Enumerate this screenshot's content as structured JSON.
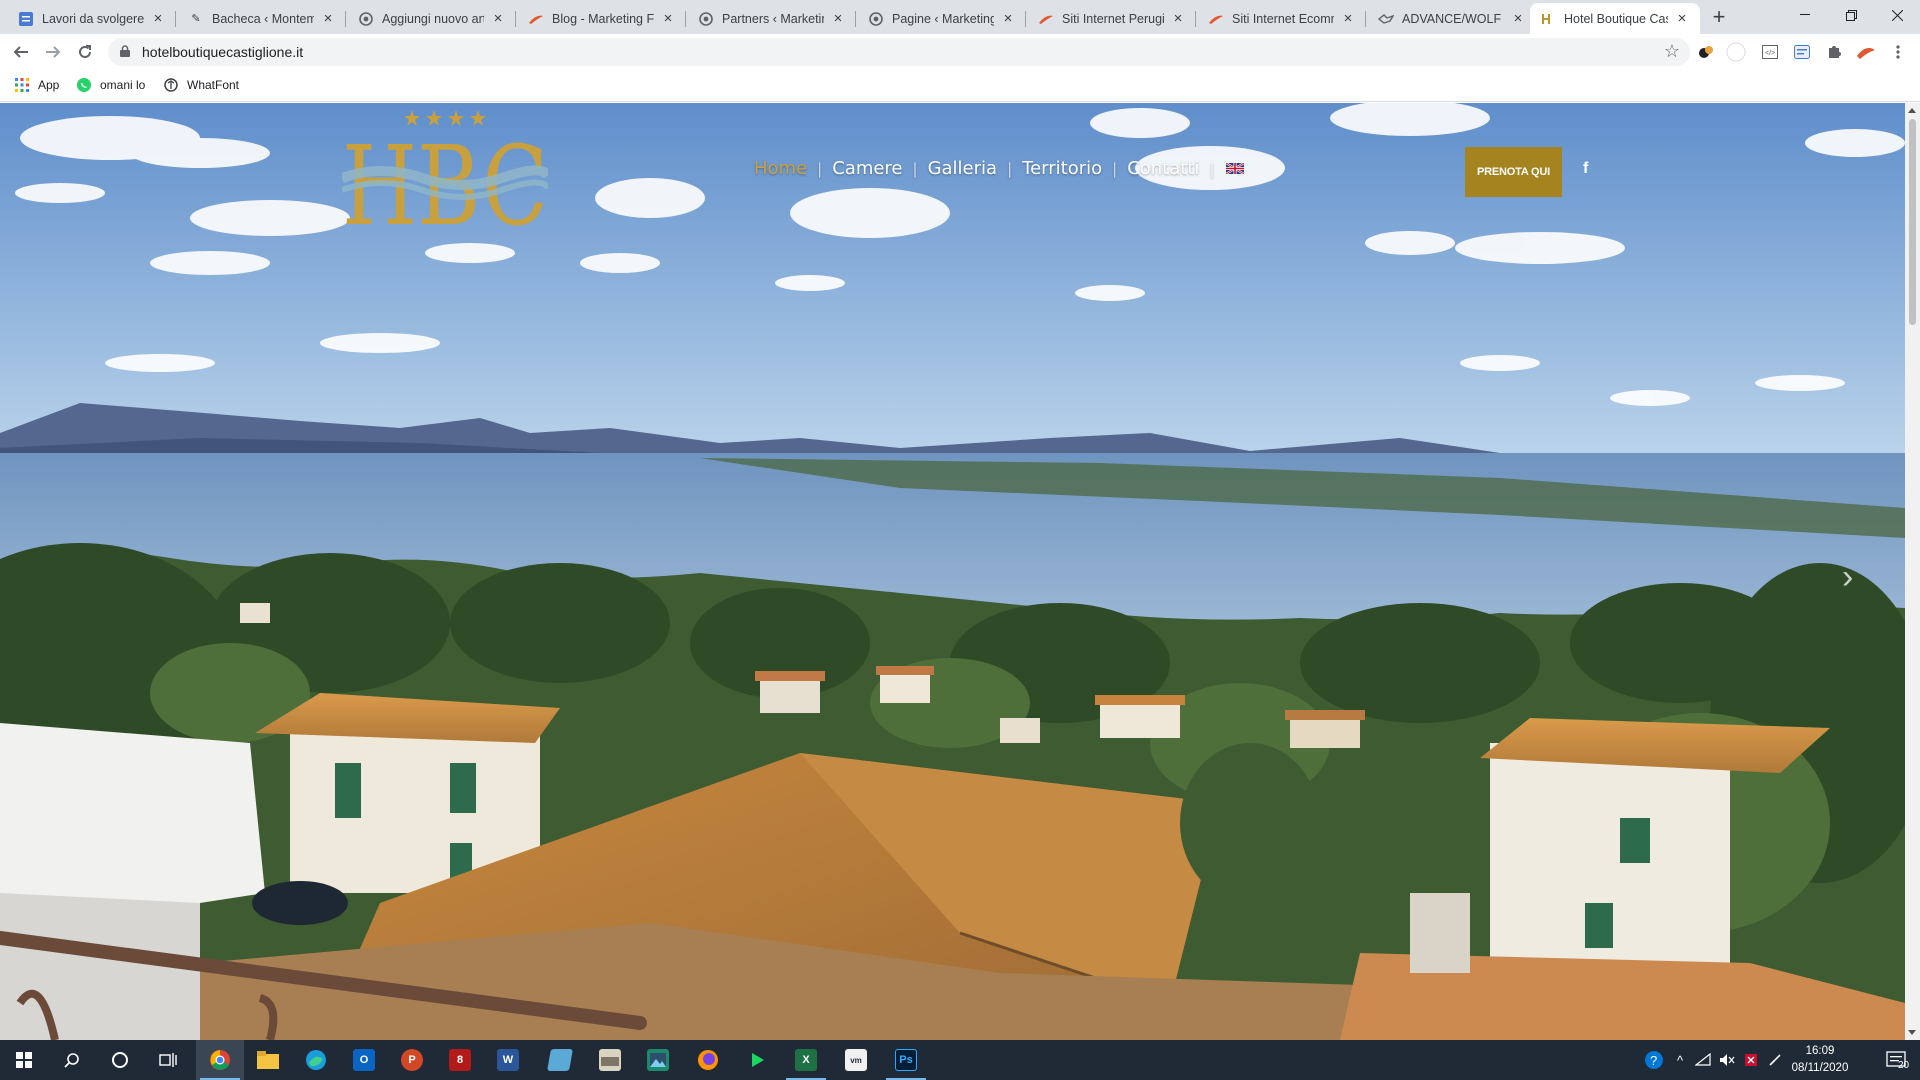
{
  "browser": {
    "tabs": [
      {
        "title": "Lavori da svolgere: I",
        "icon": "task-board-icon",
        "color": "#4a7bd0"
      },
      {
        "title": "Bacheca ‹ Montemel",
        "icon": "wordpress-feather-icon",
        "color": "#5f6368"
      },
      {
        "title": "Aggiungi nuovo art",
        "icon": "wordpress-icon",
        "color": "#5f6368"
      },
      {
        "title": "Blog - Marketing Fo",
        "icon": "orange-brush-icon",
        "color": "#e4572e"
      },
      {
        "title": "Partners ‹ Marketing",
        "icon": "wordpress-icon",
        "color": "#5f6368"
      },
      {
        "title": "Pagine ‹ Marketing",
        "icon": "wordpress-icon",
        "color": "#5f6368"
      },
      {
        "title": "Siti Internet Perugia",
        "icon": "orange-brush-icon",
        "color": "#e4572e"
      },
      {
        "title": "Siti Internet Ecomm",
        "icon": "orange-brush-icon",
        "color": "#e4572e"
      },
      {
        "title": "ADVANCE/WOLF Fi",
        "icon": "wolf-icon",
        "color": "#5f6368"
      },
      {
        "title": "Hotel Boutique Cas",
        "icon": "hbc-icon",
        "color": "#b8962e",
        "active": true
      }
    ],
    "url": "hotelboutiquecastiglione.it",
    "bookmarks": [
      {
        "label": "App",
        "icon": "apps-grid-icon"
      },
      {
        "label": "omani lo",
        "icon": "whatsapp-icon"
      },
      {
        "label": "WhatFont",
        "icon": "whatfont-icon"
      }
    ]
  },
  "site": {
    "logo_text": "HBC",
    "nav": [
      "Home",
      "Camere",
      "Galleria",
      "Territorio",
      "Contatti"
    ],
    "current_nav": "Home",
    "language_flag": "uk-flag-icon",
    "book_label": "PRENOTA QUI",
    "social_label": "f",
    "accent_color": "#a5831e"
  },
  "taskbar": {
    "clock_time": "16:09",
    "clock_date": "08/11/2020",
    "notification_count": "20",
    "apps": [
      "start-icon",
      "search-icon",
      "cortana-icon",
      "task-view-icon",
      "chrome-icon",
      "file-explorer-icon",
      "edge-icon",
      "outlook-icon",
      "powerpoint-icon",
      "pdf-icon",
      "word-icon",
      "notes-icon",
      "scanner-icon",
      "photos-icon",
      "firefox-icon",
      "terminal-icon",
      "excel-icon",
      "vmware-icon",
      "photoshop-icon"
    ]
  }
}
